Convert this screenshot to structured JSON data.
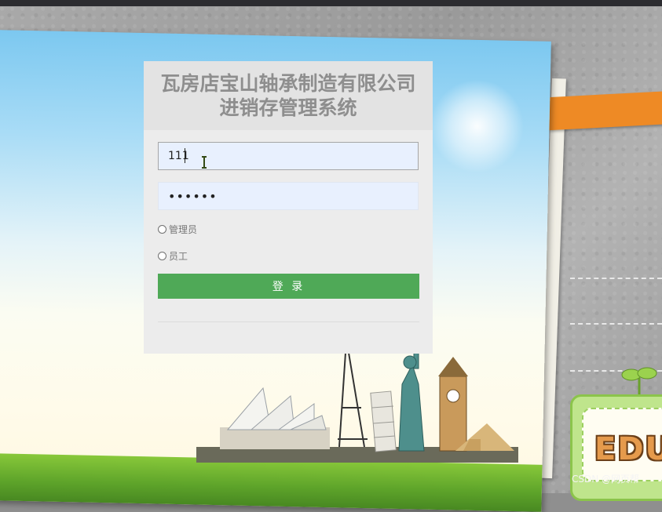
{
  "login": {
    "title": "瓦房店宝山轴承制造有限公司进销存管理系统",
    "username_value": "111",
    "password_value": "••••••",
    "roles": [
      {
        "label": "管理员"
      },
      {
        "label": "员工"
      }
    ],
    "submit_label": "登 录"
  },
  "decor": {
    "edu_text": "EDU",
    "watermark": "CSDN @网页帮"
  },
  "colors": {
    "button": "#4fa957",
    "tape": "#ee8a25",
    "input_bg": "#e8f0fe",
    "title": "#8e8e8e"
  }
}
